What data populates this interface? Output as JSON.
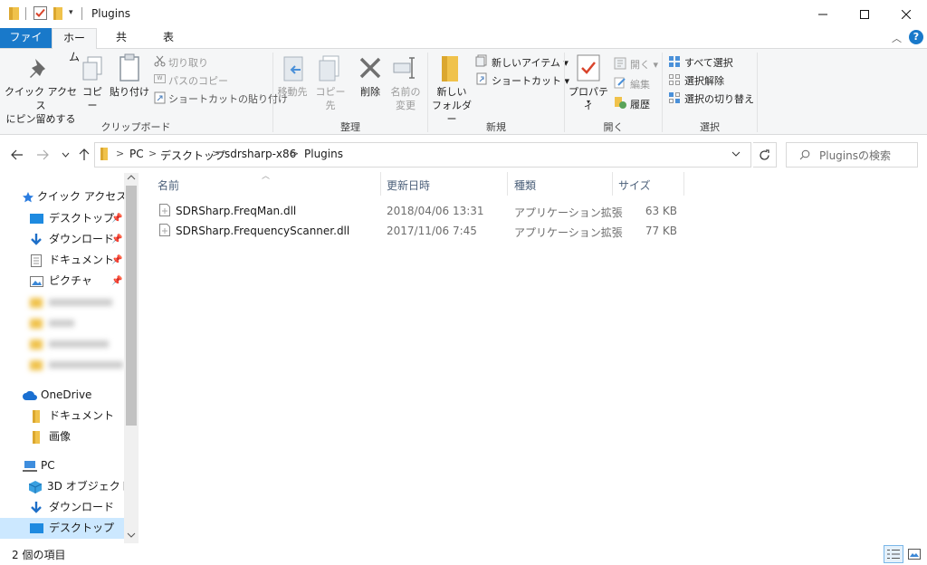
{
  "window": {
    "title": "Plugins"
  },
  "tabs": {
    "file": "ファイル",
    "home": "ホーム",
    "share": "共有",
    "view": "表示"
  },
  "ribbon": {
    "clipboard": {
      "pin_label": "クイック アクセス\nにピン留めする",
      "copy": "コピー",
      "paste": "貼り付け",
      "cut": "切り取り",
      "copy_path": "パスのコピー",
      "paste_shortcut": "ショートカットの貼り付け",
      "group": "クリップボード"
    },
    "organize": {
      "move_to": "移動先",
      "copy_to": "コピー先",
      "delete": "削除",
      "rename": "名前の\n変更",
      "group": "整理"
    },
    "new": {
      "new_item": "新しいアイテム ▾",
      "shortcut": "ショートカット ▾",
      "new_folder": "新しい\nフォルダー",
      "group": "新規"
    },
    "open": {
      "properties": "プロパティ",
      "open": "開く ▾",
      "edit": "編集",
      "history": "履歴",
      "group": "開く"
    },
    "select": {
      "select_all": "すべて選択",
      "select_none": "選択解除",
      "invert": "選択の切り替え",
      "group": "選択"
    }
  },
  "address": {
    "crumbs": [
      "PC",
      "デスクトップ",
      "sdrsharp-x86",
      "Plugins"
    ]
  },
  "search": {
    "placeholder": "Pluginsの検索"
  },
  "nav": {
    "quick_access": "クイック アクセス",
    "qa_items": [
      "デスクトップ",
      "ダウンロード",
      "ドキュメント",
      "ピクチャ"
    ],
    "onedrive": "OneDrive",
    "od_items": [
      "ドキュメント",
      "画像"
    ],
    "pc": "PC",
    "pc_items": [
      "3D オブジェクト",
      "ダウンロード",
      "デスクトップ"
    ]
  },
  "columns": {
    "name": "名前",
    "modified": "更新日時",
    "type": "種類",
    "size": "サイズ"
  },
  "files": [
    {
      "name": "SDRSharp.FreqMan.dll",
      "modified": "2018/04/06 13:31",
      "type": "アプリケーション拡張",
      "size": "63 KB"
    },
    {
      "name": "SDRSharp.FrequencyScanner.dll",
      "modified": "2017/11/06 7:45",
      "type": "アプリケーション拡張",
      "size": "77 KB"
    }
  ],
  "status": {
    "count": "2 個の項目"
  },
  "colors": {
    "accent": "#1979ca",
    "folder": "#f0c24b",
    "selected": "#cce8ff"
  }
}
